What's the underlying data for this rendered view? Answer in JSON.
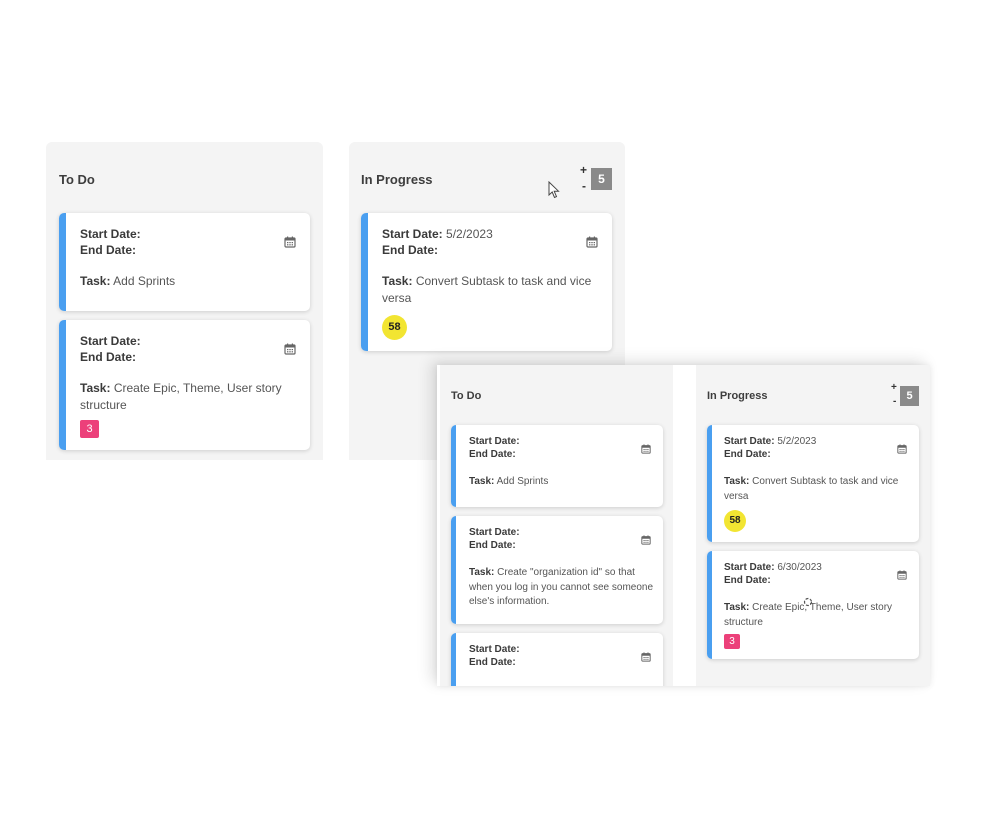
{
  "colors": {
    "accent_bar": "#4a9ff0",
    "column_bg": "#f4f4f4",
    "counter_bg": "#8a8a8a",
    "badge_yellow": "#f2e532",
    "badge_pink": "#ec407a"
  },
  "labels": {
    "start_date": "Start Date:",
    "end_date": "End Date:",
    "task": "Task:",
    "plus": "+",
    "minus": "-"
  },
  "shot1": {
    "todo": {
      "title": "To Do",
      "cards": [
        {
          "start": "",
          "end": "",
          "task": "Add Sprints",
          "icon": "calendar-icon"
        },
        {
          "start": "",
          "end": "",
          "task": "Create Epic, Theme, User story structure",
          "badge": "3",
          "icon": "calendar-icon"
        }
      ]
    },
    "inprogress": {
      "title": "In Progress",
      "count": "5",
      "cards": [
        {
          "start": "5/2/2023",
          "end": "",
          "task": "Convert Subtask to task and vice versa",
          "badge": "58",
          "icon": "calendar-icon"
        }
      ]
    }
  },
  "shot2": {
    "todo": {
      "title": "To Do",
      "cards": [
        {
          "start": "",
          "end": "",
          "task": "Add Sprints",
          "icon": "calendar-icon"
        },
        {
          "start": "",
          "end": "",
          "task": "Create \"organization id\" so that when you log in you cannot see someone else's information.",
          "icon": "calendar-icon"
        },
        {
          "start": "",
          "end": "",
          "task": "",
          "icon": "calendar-icon"
        }
      ]
    },
    "inprogress": {
      "title": "In Progress",
      "count": "5",
      "cards": [
        {
          "start": "5/2/2023",
          "end": "",
          "task": "Convert Subtask to task and vice versa",
          "badge": "58",
          "icon": "calendar-icon"
        },
        {
          "start": "6/30/2023",
          "end": "",
          "task": "Create Epic, Theme, User story structure",
          "badge": "3",
          "icon": "calendar-icon"
        }
      ]
    }
  }
}
